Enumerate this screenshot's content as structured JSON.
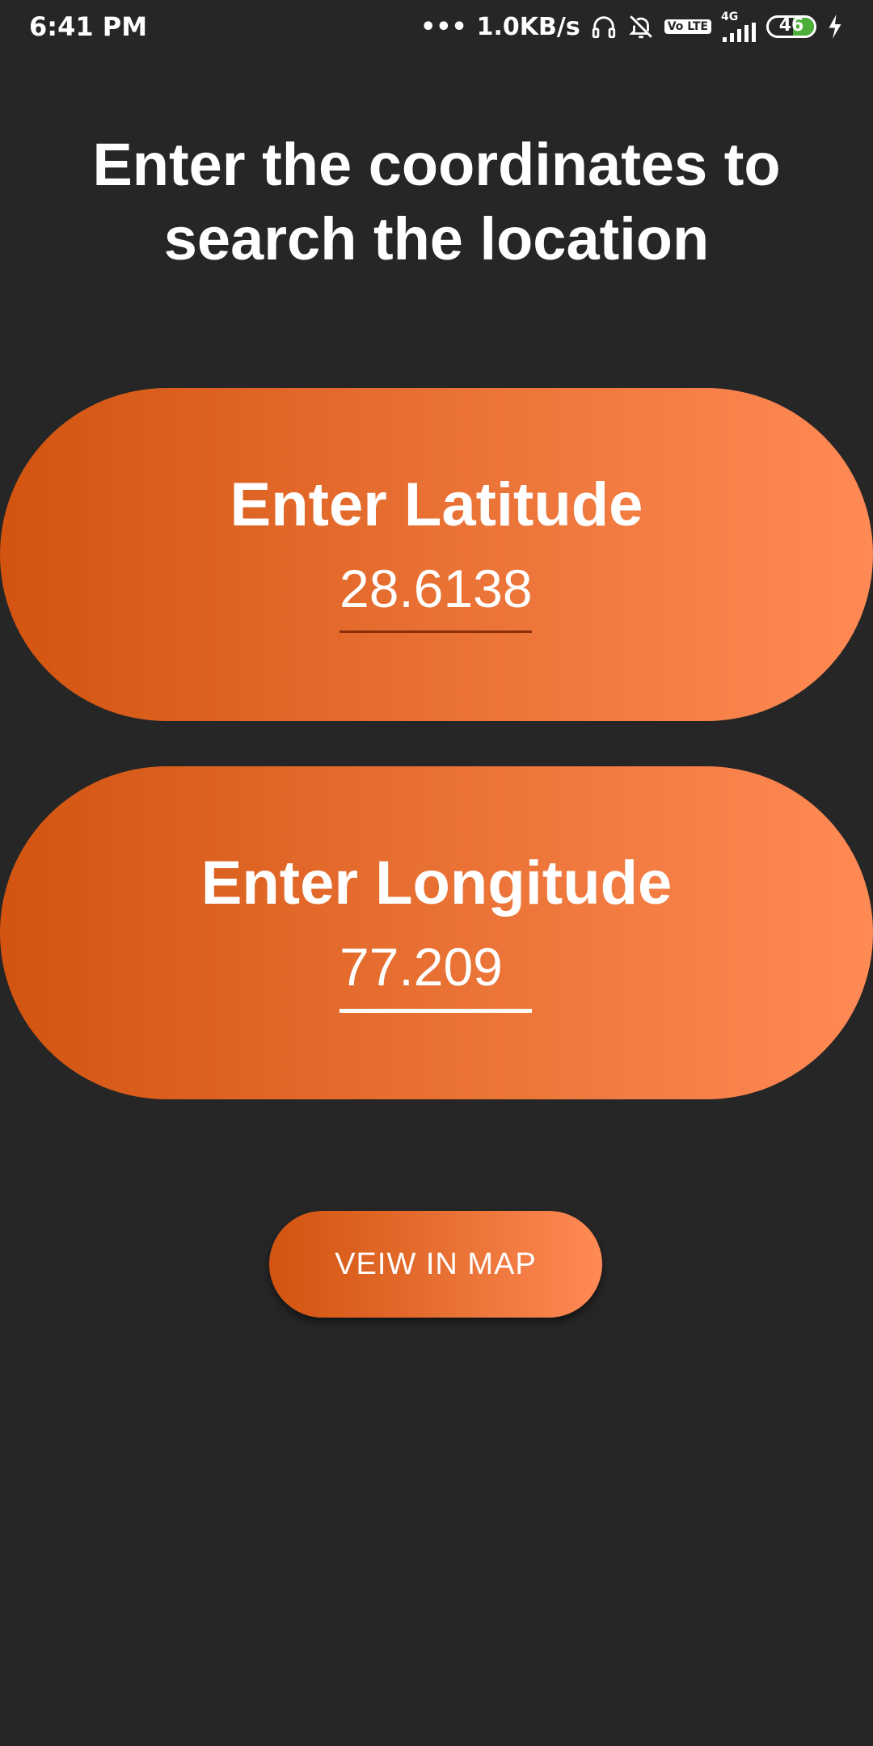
{
  "status_bar": {
    "time": "6:41 PM",
    "network_speed": "1.0KB/s",
    "dots": "•••",
    "network_type": "4G",
    "volte_label": "Vo LTE",
    "battery_level": "46",
    "icons": [
      "headset-icon",
      "notifications-muted-icon",
      "volte-icon",
      "signal-icon",
      "battery-icon",
      "charging-icon"
    ]
  },
  "heading": "Enter the coordinates to search the location",
  "latitude": {
    "label": "Enter Latitude",
    "value": "28.6138"
  },
  "longitude": {
    "label": "Enter Longitude",
    "value": "77.209"
  },
  "map_button": {
    "label": "VEIW IN MAP"
  },
  "colors": {
    "background": "#262626",
    "gradient_start": "#d25410",
    "gradient_end": "#ff8a55",
    "text": "#ffffff"
  }
}
